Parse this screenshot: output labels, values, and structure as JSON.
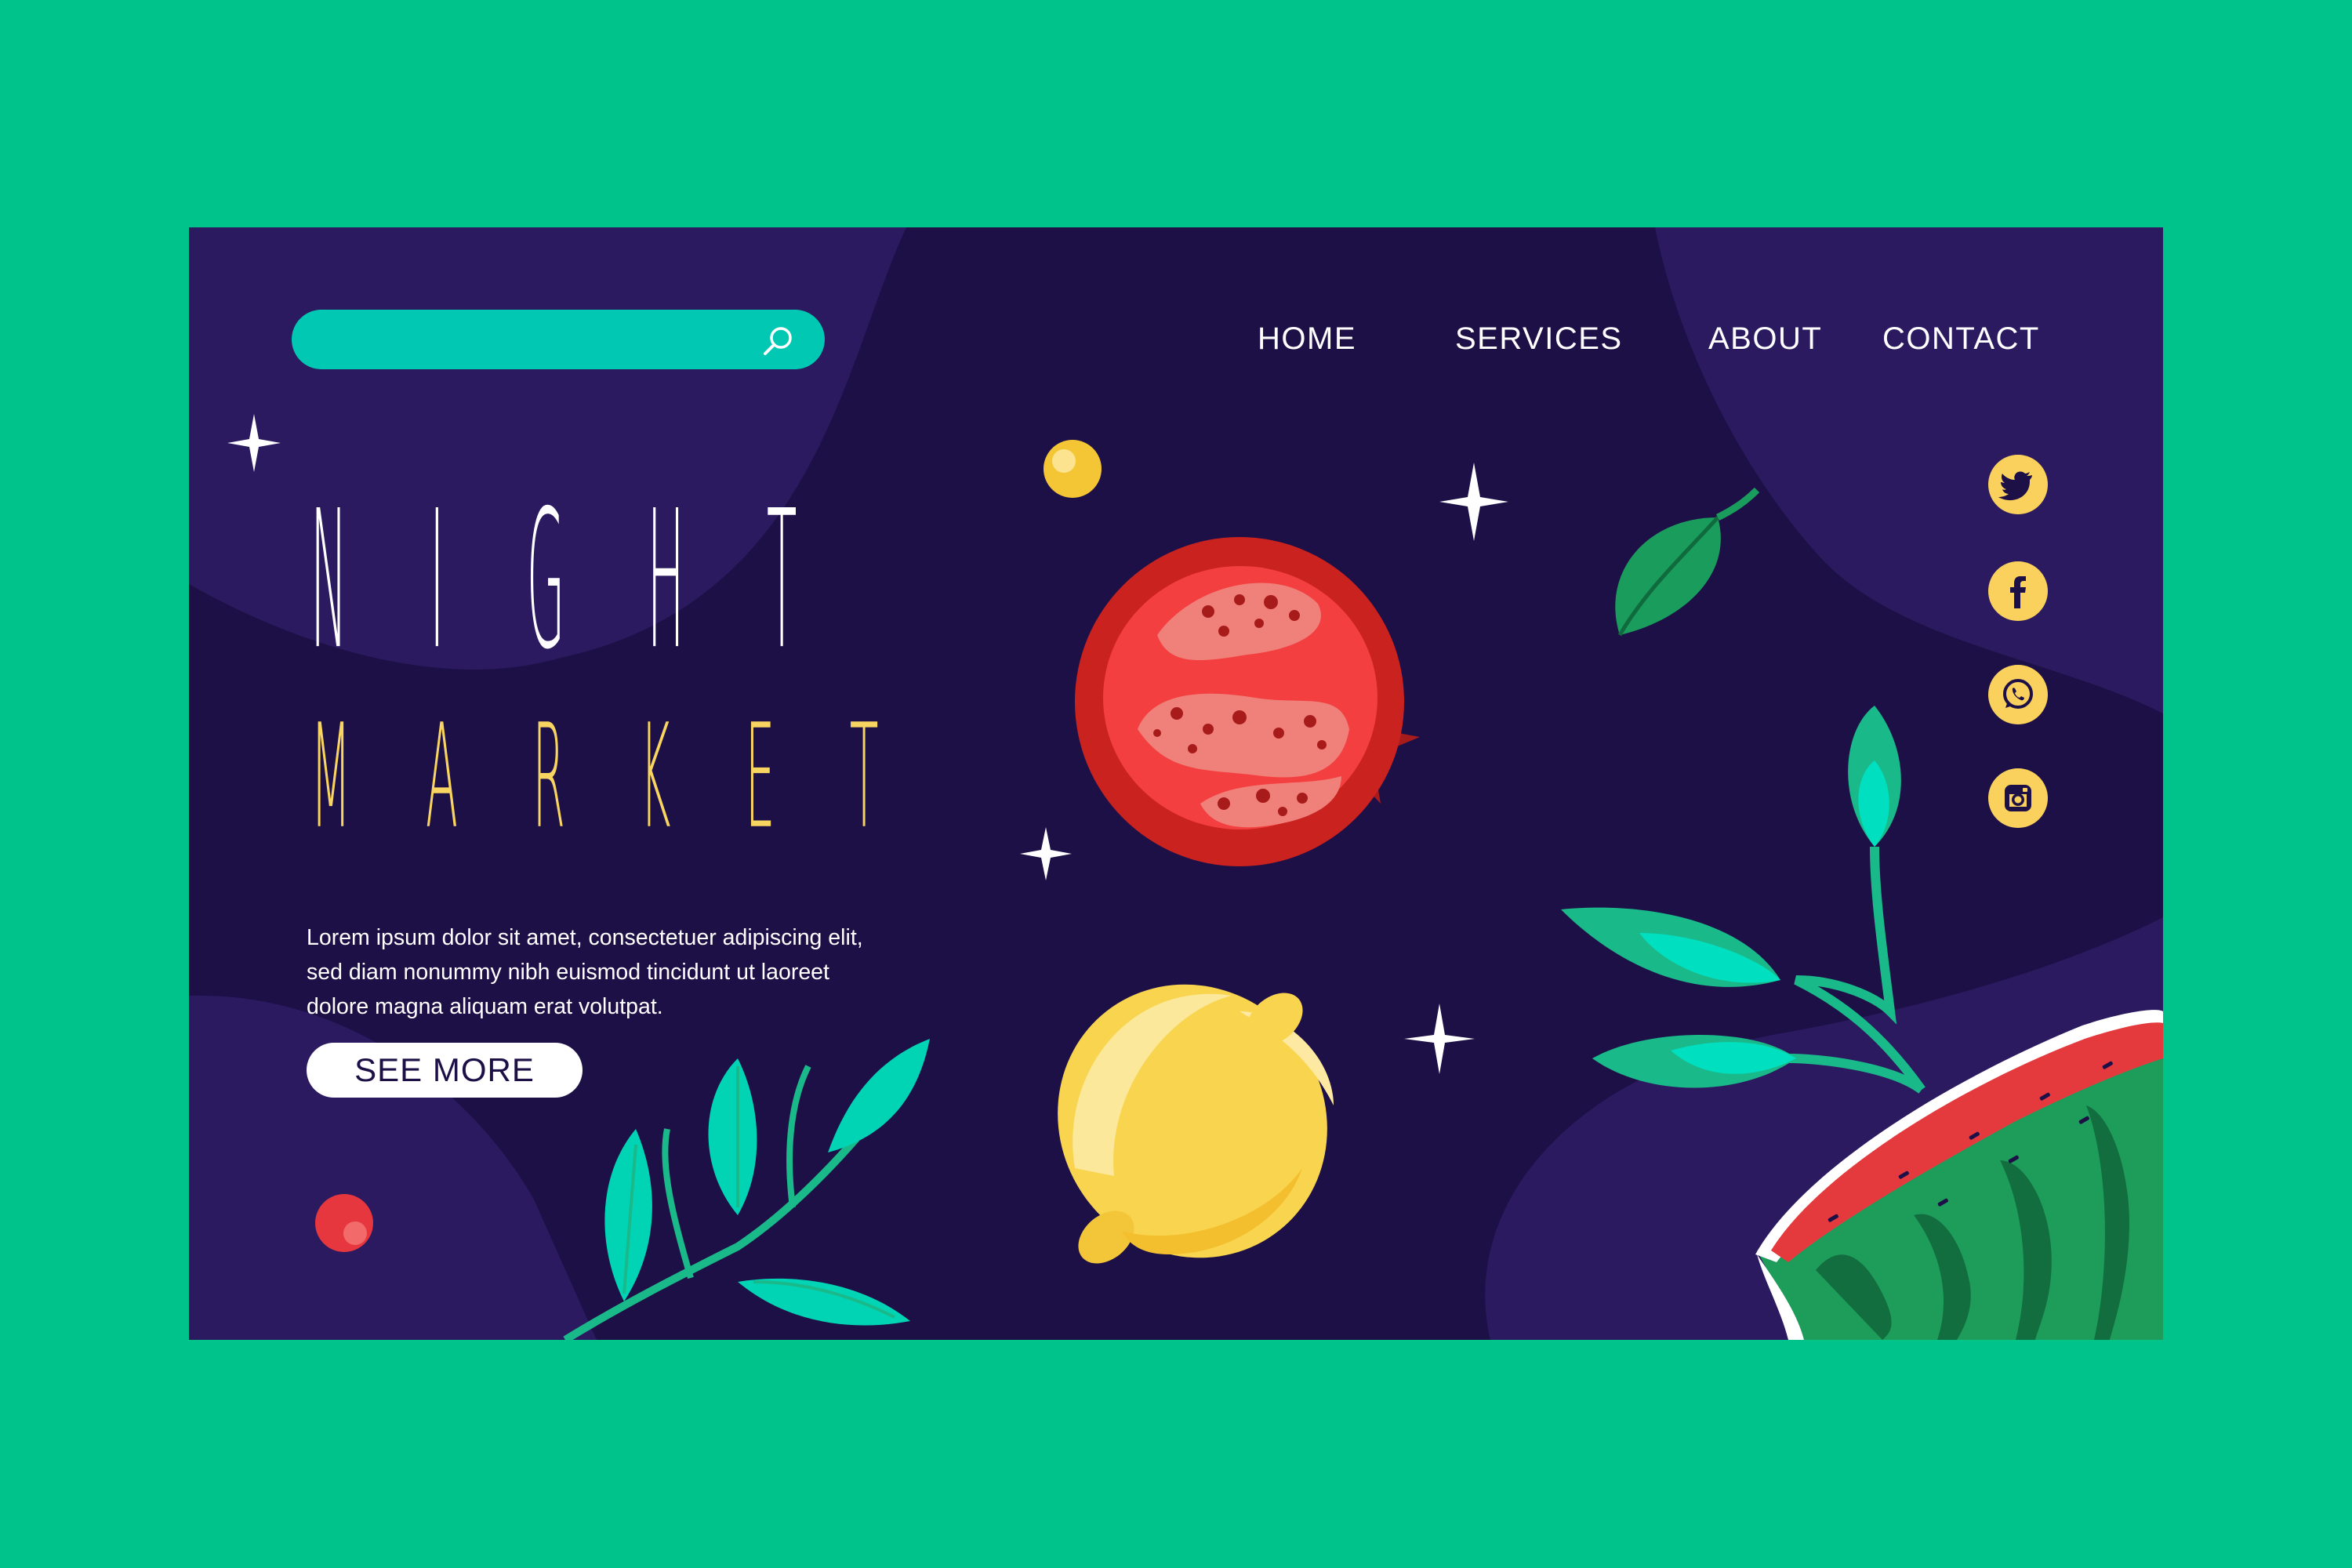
{
  "theme": {
    "page_background": "#00c38c",
    "panel_background": "#1d1047",
    "accent_teal": "#00c8b2",
    "accent_yellow": "#f8d461",
    "text_white": "#ffffff"
  },
  "header": {
    "search": {
      "value": "",
      "placeholder": "",
      "icon": "search-icon"
    },
    "nav": [
      {
        "id": "home",
        "label": "HOME"
      },
      {
        "id": "services",
        "label": "SERVICES"
      },
      {
        "id": "about",
        "label": "ABOUT"
      },
      {
        "id": "contact",
        "label": "CONTACT"
      }
    ]
  },
  "hero": {
    "title_line1": "NIGHT",
    "title_line2": "MARKET",
    "description_lines": [
      "Lorem ipsum dolor sit amet, consectetuer adipiscing elit,",
      "sed diam nonummy nibh euismod tincidunt ut laoreet",
      "dolore magna aliquam erat volutpat."
    ],
    "cta_label": "SEE MORE"
  },
  "social": [
    {
      "icon": "twitter-icon"
    },
    {
      "icon": "facebook-icon"
    },
    {
      "icon": "whatsapp-icon"
    },
    {
      "icon": "instagram-icon"
    }
  ],
  "illustrations": [
    "pomegranate-illustration",
    "lemon-illustration",
    "watermelon-illustration",
    "leaf-branch-illustration",
    "sparkle-icon",
    "yellow-dot",
    "red-dot"
  ]
}
